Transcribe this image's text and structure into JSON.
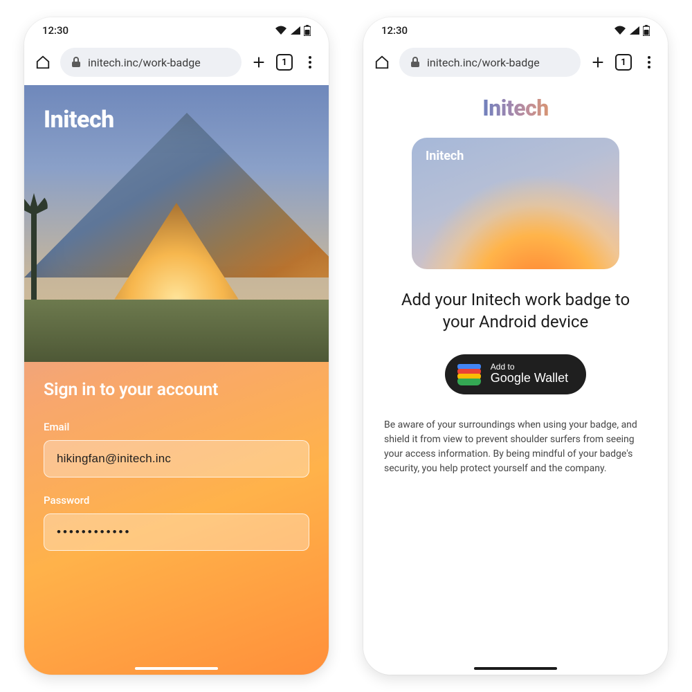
{
  "statusbar": {
    "time": "12:30"
  },
  "browser": {
    "url": "initech.inc/work-badge",
    "tab_count": "1"
  },
  "phone1": {
    "brand": "Initech",
    "signin_heading": "Sign in to your account",
    "email_label": "Email",
    "email_value": "hikingfan@initech.inc",
    "password_label": "Password",
    "password_value": "••••••••••••"
  },
  "phone2": {
    "brand": "Initech",
    "card_label": "Initech",
    "headline": "Add your Initech work badge to your Android device",
    "wallet_small": "Add to",
    "wallet_big": "Google Wallet",
    "disclaimer": "Be aware of your surroundings when using your badge, and shield it from view to prevent shoulder surfers from seeing your access information.  By being mindful of your badge's security, you help protect yourself and the company."
  }
}
